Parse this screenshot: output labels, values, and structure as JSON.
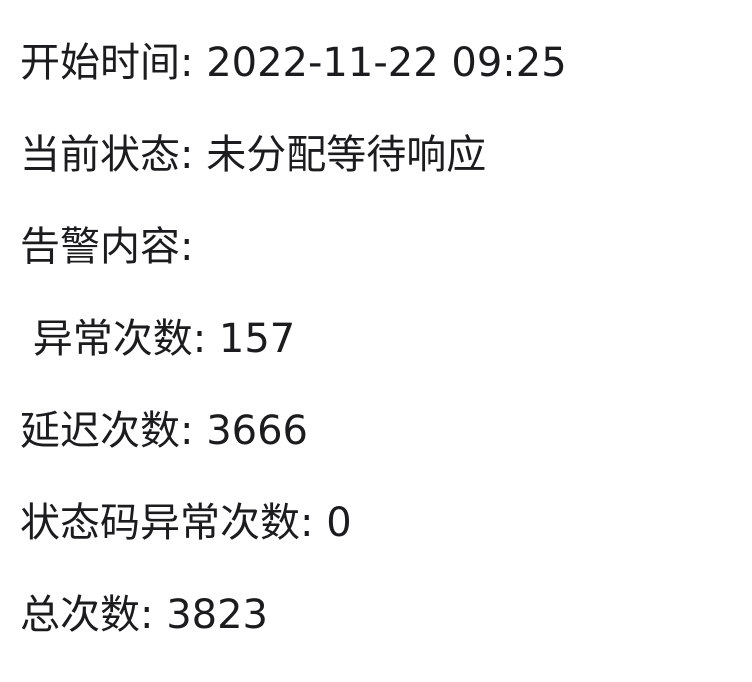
{
  "alert": {
    "start_time": "开始时间: 2022-11-22 09:25",
    "current_status": "当前状态: 未分配等待响应",
    "content_heading": "告警内容:",
    "error_count": " 异常次数: 157",
    "delay_count": "延迟次数: 3666",
    "status_code_error_count": "状态码异常次数: 0",
    "total_count": "总次数: 3823"
  }
}
